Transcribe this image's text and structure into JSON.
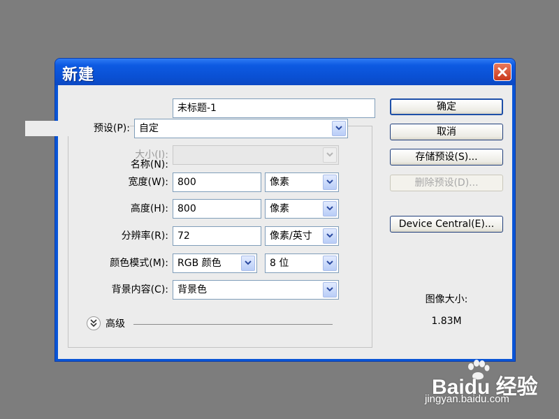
{
  "window": {
    "title": "新建"
  },
  "form": {
    "name": {
      "label": "名称(N):",
      "value": "未标题-1"
    },
    "preset": {
      "label": "预设(P):",
      "value": "自定"
    },
    "size": {
      "label": "大小(I):",
      "value": ""
    },
    "width": {
      "label": "宽度(W):",
      "value": "800",
      "unit": "像素"
    },
    "height": {
      "label": "高度(H):",
      "value": "800",
      "unit": "像素"
    },
    "resolution": {
      "label": "分辨率(R):",
      "value": "72",
      "unit": "像素/英寸"
    },
    "color_mode": {
      "label": "颜色模式(M):",
      "value": "RGB 颜色",
      "depth": "8 位"
    },
    "background": {
      "label": "背景内容(C):",
      "value": "背景色"
    },
    "advanced_label": "高级"
  },
  "buttons": {
    "ok": "确定",
    "cancel": "取消",
    "save_preset": "存储预设(S)...",
    "delete_preset": "删除预设(D)...",
    "device_central": "Device Central(E)..."
  },
  "image_size": {
    "label": "图像大小:",
    "value": "1.83M"
  },
  "watermark": {
    "brand": "Baidu 经验",
    "url": "jingyan.baidu.com"
  },
  "colors": {
    "titlebar": "#0a50d3",
    "close": "#d9481f",
    "dialog_bg": "#ececec"
  },
  "icons": [
    "close-icon",
    "chevron-down-icon",
    "double-chevron-down-icon",
    "paw-icon"
  ]
}
